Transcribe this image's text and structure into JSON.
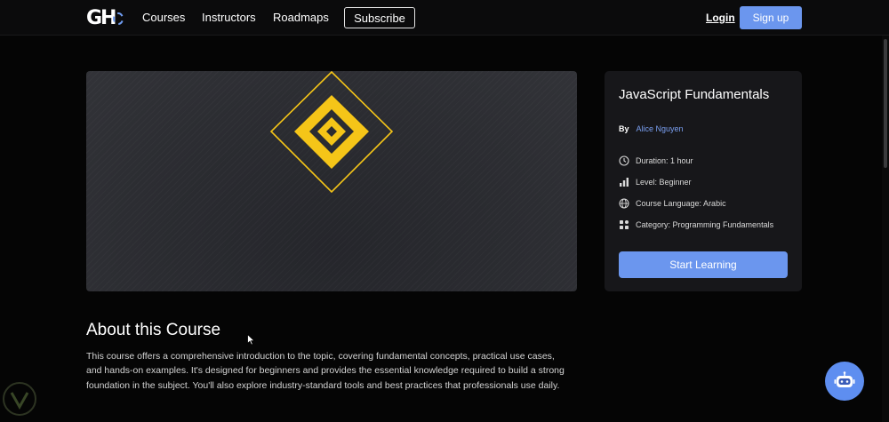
{
  "nav": {
    "logo_text": "GH",
    "links": [
      "Courses",
      "Instructors",
      "Roadmaps"
    ],
    "subscribe": "Subscribe",
    "login": "Login",
    "signup": "Sign up"
  },
  "course": {
    "title": "JavaScript Fundamentals",
    "by_label": "By",
    "author": "Alice Nguyen",
    "duration": "Duration: 1 hour",
    "level": "Level: Beginner",
    "language": "Course Language: Arabic",
    "category": "Category: Programming Fundamentals",
    "cta": "Start Learning"
  },
  "about": {
    "heading": "About this Course",
    "body": "This course offers a comprehensive introduction to the topic, covering fundamental concepts, practical use cases, and hands-on examples. It's designed for beginners and provides the essential knowledge required to build a strong foundation in the subject. You'll also explore industry-standard tools and best practices that professionals use daily."
  },
  "colors": {
    "accent": "#6b96ee",
    "logo_yellow": "#f5c518",
    "background": "#050505",
    "card": "#17171a"
  },
  "icons": {
    "logo": "gh-gear-logo",
    "duration": "clock-icon",
    "level": "bar-chart-icon",
    "language": "globe-icon",
    "category": "grid-icon",
    "chatbot": "robot-icon"
  }
}
